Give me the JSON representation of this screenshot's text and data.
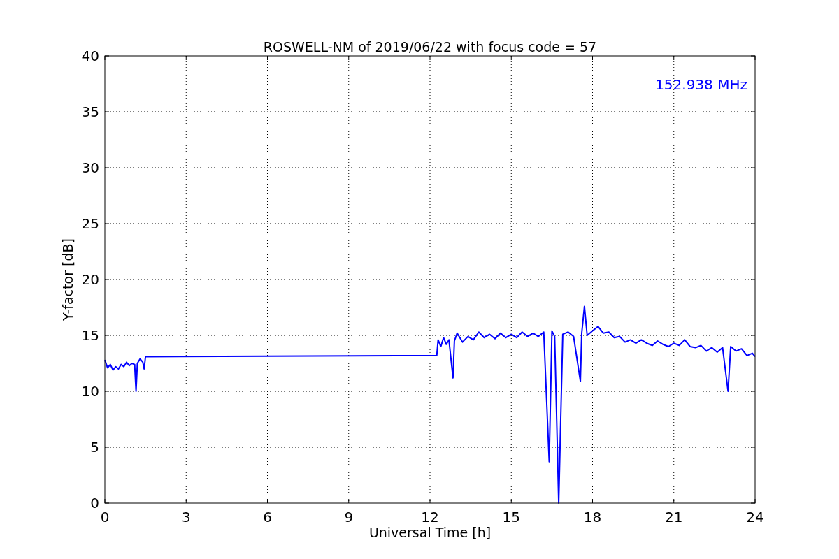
{
  "chart_data": {
    "type": "line",
    "title": "ROSWELL-NM of 2019/06/22 with focus code = 57",
    "xlabel": "Universal Time [h]",
    "ylabel": "Y-factor [dB]",
    "xlim": [
      0,
      24
    ],
    "ylim": [
      0,
      40
    ],
    "xticks": [
      0,
      3,
      6,
      9,
      12,
      15,
      18,
      21,
      24
    ],
    "yticks": [
      0,
      5,
      10,
      15,
      20,
      25,
      30,
      35,
      40
    ],
    "grid": true,
    "x": [
      0,
      0.1,
      0.2,
      0.3,
      0.4,
      0.5,
      0.6,
      0.7,
      0.8,
      0.9,
      1.0,
      1.1,
      1.15,
      1.2,
      1.3,
      1.4,
      1.45,
      1.5,
      12.25,
      12.3,
      12.4,
      12.5,
      12.6,
      12.7,
      12.85,
      12.9,
      13.0,
      13.2,
      13.4,
      13.6,
      13.8,
      14.0,
      14.2,
      14.4,
      14.6,
      14.8,
      15.0,
      15.2,
      15.4,
      15.6,
      15.8,
      16.0,
      16.2,
      16.4,
      16.5,
      16.6,
      16.75,
      16.9,
      17.1,
      17.3,
      17.55,
      17.6,
      17.7,
      17.8,
      18.0,
      18.2,
      18.4,
      18.6,
      18.8,
      19.0,
      19.2,
      19.4,
      19.6,
      19.8,
      20.0,
      20.2,
      20.4,
      20.6,
      20.8,
      21.0,
      21.2,
      21.4,
      21.6,
      21.8,
      22.0,
      22.2,
      22.4,
      22.6,
      22.8,
      23.0,
      23.1,
      23.3,
      23.5,
      23.7,
      23.9,
      24.0
    ],
    "series": [
      {
        "name": "152.938 MHz",
        "color": "#0000ff",
        "values": [
          12.8,
          12.1,
          12.4,
          11.9,
          12.2,
          12.0,
          12.4,
          12.2,
          12.6,
          12.3,
          12.5,
          12.4,
          10.0,
          12.5,
          12.9,
          12.6,
          12.0,
          13.1,
          13.2,
          14.6,
          14.0,
          14.8,
          14.2,
          14.6,
          11.2,
          14.5,
          15.2,
          14.4,
          14.9,
          14.6,
          15.3,
          14.8,
          15.1,
          14.7,
          15.2,
          14.8,
          15.1,
          14.8,
          15.3,
          14.9,
          15.2,
          14.9,
          15.3,
          3.7,
          15.4,
          14.9,
          0,
          15.1,
          15.3,
          14.9,
          10.9,
          15.2,
          17.6,
          15.0,
          15.4,
          15.8,
          15.2,
          15.3,
          14.8,
          14.9,
          14.4,
          14.6,
          14.3,
          14.6,
          14.3,
          14.1,
          14.5,
          14.2,
          14.0,
          14.3,
          14.1,
          14.6,
          14.0,
          13.9,
          14.1,
          13.6,
          13.9,
          13.5,
          13.9,
          10.0,
          14.0,
          13.6,
          13.8,
          13.2,
          13.4,
          13.1
        ]
      }
    ]
  }
}
